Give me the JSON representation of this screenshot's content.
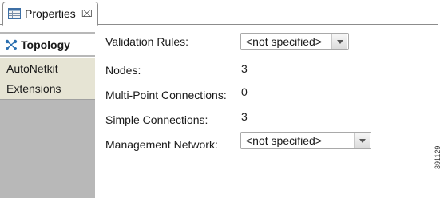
{
  "tab": {
    "title": "Properties",
    "icon": "properties-table-icon",
    "close_glyph": "⌧"
  },
  "nav": {
    "items": [
      {
        "label": "Topology",
        "icon": "topology-icon",
        "selected": true
      },
      {
        "label": "AutoNetkit",
        "selected": false
      },
      {
        "label": "Extensions",
        "selected": false
      }
    ]
  },
  "form": {
    "validation_rules": {
      "label": "Validation Rules:",
      "value": "<not specified>"
    },
    "nodes": {
      "label": "Nodes:",
      "value": "3"
    },
    "multipoint": {
      "label": "Multi-Point Connections:",
      "value": "0"
    },
    "simple": {
      "label": "Simple Connections:",
      "value": "3"
    },
    "management": {
      "label": "Management Network:",
      "value": "<not specified>"
    }
  },
  "figure_id": "391129",
  "colors": {
    "nav_bg": "#b8b8b8",
    "nav_item_bg": "#e6e4d4",
    "selected_bg": "#ffffff",
    "topology_icon": "#2a6fb0"
  }
}
